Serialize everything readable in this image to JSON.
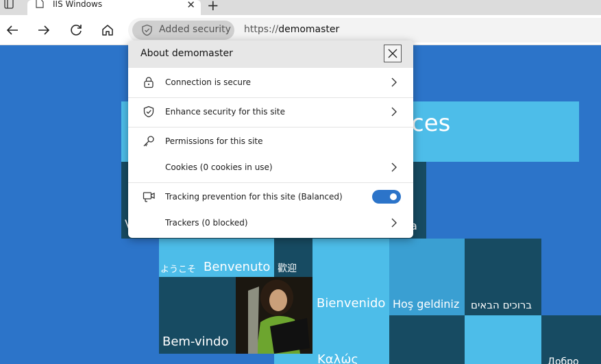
{
  "browser": {
    "tab": {
      "title": "IIS Windows"
    },
    "address_bar": {
      "security_label": "Added security",
      "url_protocol": "https://",
      "url_host": "demomaster"
    }
  },
  "popup": {
    "title": "About demomaster",
    "rows": [
      {
        "label": "Connection is secure",
        "icon": "lock-icon",
        "has_chevron": true
      },
      {
        "label": "Enhance security for this site",
        "icon": "shield-check-icon",
        "has_chevron": true
      },
      {
        "label": "Permissions for this site",
        "icon": "key-icon",
        "has_chevron": false
      },
      {
        "label": "Cookies (0 cookies in use)",
        "icon": null,
        "has_chevron": true
      },
      {
        "label": "Tracking prevention for this site (Balanced)",
        "icon": "tracking-icon",
        "toggle_on": true
      },
      {
        "label": "Trackers (0 blocked)",
        "icon": null,
        "has_chevron": true
      }
    ]
  },
  "page": {
    "partial_heading": "ces",
    "welcome_words": [
      "ようこそ",
      "Benvenuto",
      "歡迎",
      "Bienvenido",
      "Hoş geldiniz",
      "ברוכים הבאים",
      "Bem-vindo",
      "Καλώς",
      "Добро"
    ],
    "partial_left": "V",
    "partial_right": "a"
  },
  "colors": {
    "page_background": "#2c74c9",
    "tile_light": "#4dbde9",
    "tile_dark": "#174b62",
    "toggle_on": "#2c74c9"
  }
}
